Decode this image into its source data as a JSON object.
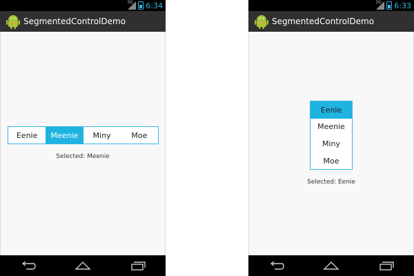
{
  "screens": [
    {
      "status": {
        "time": "6:34",
        "network": "3G"
      },
      "app_title": "SegmentedControlDemo",
      "segments": [
        "Eenie",
        "Meenie",
        "Miny",
        "Moe"
      ],
      "selected_index": 1,
      "selected_text": "Selected: Meenie"
    },
    {
      "status": {
        "time": "6:33",
        "network": "3G"
      },
      "app_title": "SegmentedControlDemo",
      "segments": [
        "Eenie",
        "Meenie",
        "Miny",
        "Moe"
      ],
      "selected_index": 0,
      "selected_text": "Selected: Eenie"
    }
  ],
  "icons": {
    "app": "android-icon",
    "back": "back-icon",
    "home": "home-icon",
    "recents": "recent-apps-icon",
    "signal": "signal-icon",
    "battery": "battery-icon"
  },
  "colors": {
    "accent": "#33b5e5",
    "selected_segment": "#1fb3e0",
    "action_bar": "#303030",
    "status_bar": "#000000"
  }
}
